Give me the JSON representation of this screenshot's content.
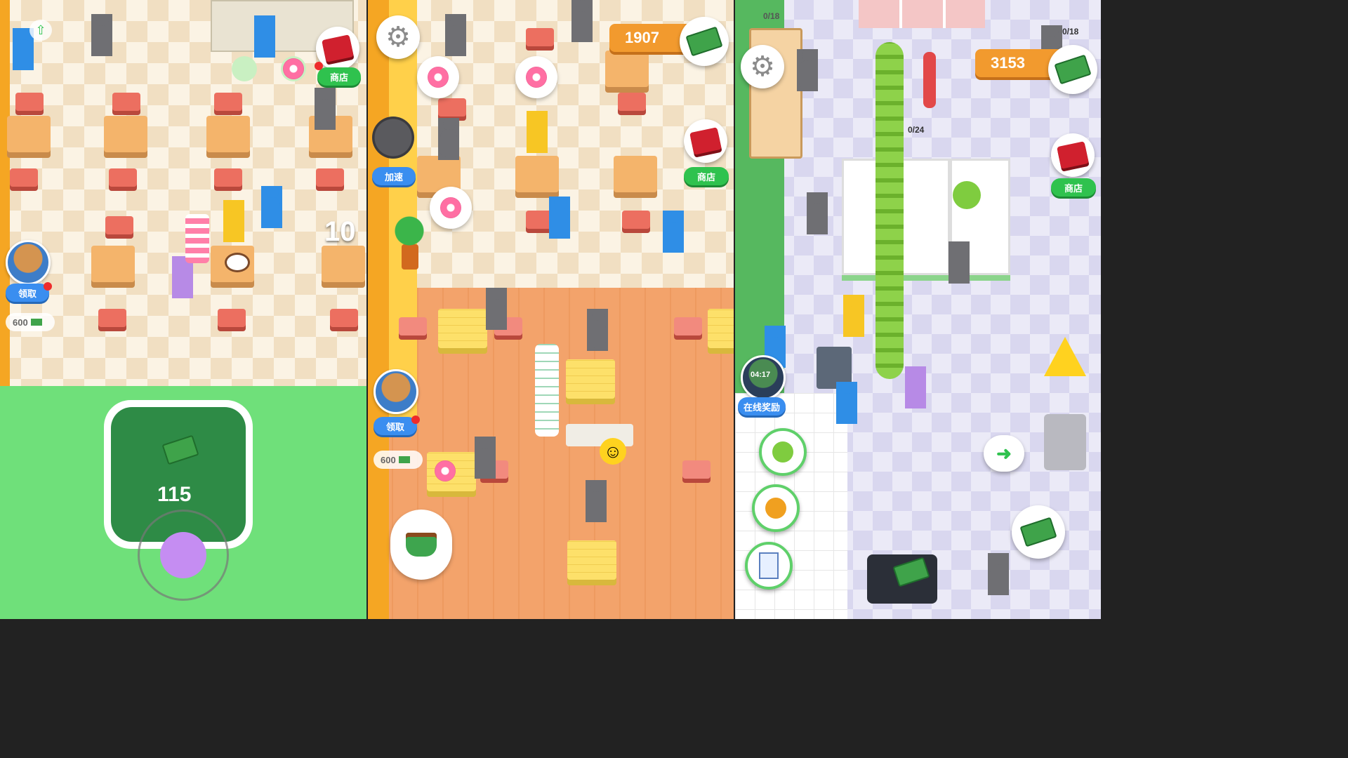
{
  "panels": [
    {
      "shop_label": "商店",
      "claim_label": "领取",
      "reward_amount": "600",
      "joystick_cash_amount": "115",
      "floating_count": "10"
    },
    {
      "money": "1907",
      "shop_label": "商店",
      "speedup_label": "加速",
      "claim_label": "领取",
      "reward_amount": "600"
    },
    {
      "money": "3153",
      "shop_label": "商店",
      "online_reward_label": "在线奖励",
      "online_timer": "04:17",
      "capacity_top": "0/18",
      "capacity_right": "0/18",
      "broccoli_counter": "0/24"
    }
  ],
  "icons": {
    "settings": "gear-icon",
    "shop": "gift-box-icon",
    "cash": "cash-stack-icon",
    "donut": "donut-icon",
    "coffee": "coffee-cup-icon",
    "broccoli": "broccoli-icon",
    "orange": "orange-icon",
    "milk": "milk-carton-icon",
    "smiley": "smiley-icon",
    "wet_floor": "wet-floor-sign-icon",
    "arrow": "green-arrow-icon"
  },
  "colors": {
    "green_button": "#2fc24e",
    "blue_button": "#3a8ef0",
    "money_bar": "#f29a2e",
    "joystick_field": "#6fe07a"
  }
}
